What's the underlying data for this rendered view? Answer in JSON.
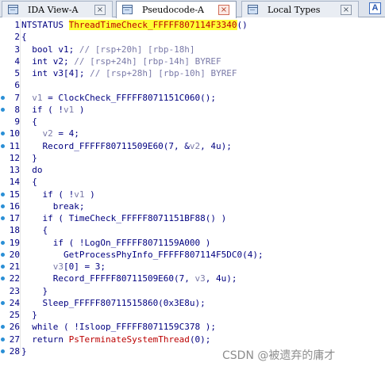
{
  "tabs": [
    {
      "label": "IDA View-A",
      "close": "×",
      "active": false
    },
    {
      "label": "Pseudocode-A",
      "close": "×",
      "active": true
    },
    {
      "label": "Local Types",
      "close": "×",
      "active": false
    }
  ],
  "overflow_tab_glyph": "A",
  "code_lines": [
    {
      "num": "1",
      "segments": [
        [
          "NTSTATUS ",
          "c-type"
        ],
        [
          "ThreadTimeCheck_FFFFF807114F3340",
          "c-hl"
        ],
        [
          "()",
          "c-type"
        ]
      ]
    },
    {
      "num": "2",
      "segments": [
        [
          "{",
          "c-type"
        ]
      ]
    },
    {
      "num": "3",
      "segments": [
        [
          "  bool ",
          "c-type"
        ],
        [
          "v1",
          "c-var"
        ],
        [
          "; ",
          "c-type"
        ],
        [
          "// [rsp+20h] [rbp-18h]",
          "c-cmt"
        ]
      ]
    },
    {
      "num": "4",
      "segments": [
        [
          "  int ",
          "c-type"
        ],
        [
          "v2",
          "c-var"
        ],
        [
          "; ",
          "c-type"
        ],
        [
          "// [rsp+24h] [rbp-14h] BYREF",
          "c-cmt"
        ]
      ]
    },
    {
      "num": "5",
      "segments": [
        [
          "  int ",
          "c-type"
        ],
        [
          "v3",
          "c-var"
        ],
        [
          "[4]; ",
          "c-type"
        ],
        [
          "// [rsp+28h] [rbp-10h] BYREF",
          "c-cmt"
        ]
      ]
    },
    {
      "num": "6",
      "segments": [
        [
          "",
          "c-type"
        ]
      ]
    },
    {
      "num": "7",
      "bp": true,
      "segments": [
        [
          "  ",
          "c-type"
        ],
        [
          "v1",
          "c-var2"
        ],
        [
          " = ClockCheck_FFFFF8071151C060();",
          "c-fn"
        ]
      ]
    },
    {
      "num": "8",
      "bp": true,
      "segments": [
        [
          "  if ( !",
          "c-type"
        ],
        [
          "v1",
          "c-var2"
        ],
        [
          " )",
          "c-type"
        ]
      ]
    },
    {
      "num": "9",
      "segments": [
        [
          "  {",
          "c-type"
        ]
      ]
    },
    {
      "num": "10",
      "bp": true,
      "segments": [
        [
          "    ",
          "c-type"
        ],
        [
          "v2",
          "c-var2"
        ],
        [
          " = 4;",
          "c-num"
        ]
      ]
    },
    {
      "num": "11",
      "bp": true,
      "segments": [
        [
          "    Record_FFFFF80711509E60(7, &",
          "c-fn"
        ],
        [
          "v2",
          "c-var2"
        ],
        [
          ", 4u);",
          "c-num"
        ]
      ]
    },
    {
      "num": "12",
      "segments": [
        [
          "  }",
          "c-type"
        ]
      ]
    },
    {
      "num": "13",
      "segments": [
        [
          "  do",
          "c-type"
        ]
      ]
    },
    {
      "num": "14",
      "segments": [
        [
          "  {",
          "c-type"
        ]
      ]
    },
    {
      "num": "15",
      "bp": true,
      "segments": [
        [
          "    if ( !",
          "c-type"
        ],
        [
          "v1",
          "c-var2"
        ],
        [
          " )",
          "c-type"
        ]
      ]
    },
    {
      "num": "16",
      "bp": true,
      "segments": [
        [
          "      break;",
          "c-type"
        ]
      ]
    },
    {
      "num": "17",
      "bp": true,
      "segments": [
        [
          "    if ( TimeCheck_FFFFF8071151BF88() )",
          "c-fn"
        ]
      ]
    },
    {
      "num": "18",
      "segments": [
        [
          "    {",
          "c-type"
        ]
      ]
    },
    {
      "num": "19",
      "bp": true,
      "segments": [
        [
          "      if ( !LogOn_FFFFF8071159A000 )",
          "c-fn"
        ]
      ]
    },
    {
      "num": "20",
      "bp": true,
      "segments": [
        [
          "        GetProcessPhyInfo_FFFFF807114F5DC0(4);",
          "c-fn"
        ]
      ]
    },
    {
      "num": "21",
      "bp": true,
      "segments": [
        [
          "      ",
          "c-type"
        ],
        [
          "v3",
          "c-var2"
        ],
        [
          "[0] = 3;",
          "c-num"
        ]
      ]
    },
    {
      "num": "22",
      "bp": true,
      "segments": [
        [
          "      Record_FFFFF80711509E60(7, ",
          "c-fn"
        ],
        [
          "v3",
          "c-var2"
        ],
        [
          ", 4u);",
          "c-num"
        ]
      ]
    },
    {
      "num": "23",
      "segments": [
        [
          "    }",
          "c-type"
        ]
      ]
    },
    {
      "num": "24",
      "bp": true,
      "segments": [
        [
          "    Sleep_FFFFF80711515860(0x3E8u);",
          "c-fn"
        ]
      ]
    },
    {
      "num": "25",
      "segments": [
        [
          "  }",
          "c-type"
        ]
      ]
    },
    {
      "num": "26",
      "bp": true,
      "segments": [
        [
          "  while ( !Isloop_FFFFF8071159C378 );",
          "c-fn"
        ]
      ]
    },
    {
      "num": "27",
      "bp": true,
      "segments": [
        [
          "  return ",
          "c-type"
        ],
        [
          "PsTerminateSystemThread",
          "c-fn-neg"
        ],
        [
          "(0);",
          "c-num"
        ]
      ]
    },
    {
      "num": "28",
      "bp": true,
      "segments": [
        [
          "}",
          "c-type"
        ]
      ]
    }
  ],
  "watermark": "CSDN @被遗弃的庸才",
  "colors": {
    "keyword": "#000080",
    "comment": "#7a7aa8",
    "highlight_bg": "#ffff33",
    "breakpoint": "#2a8fd6"
  }
}
